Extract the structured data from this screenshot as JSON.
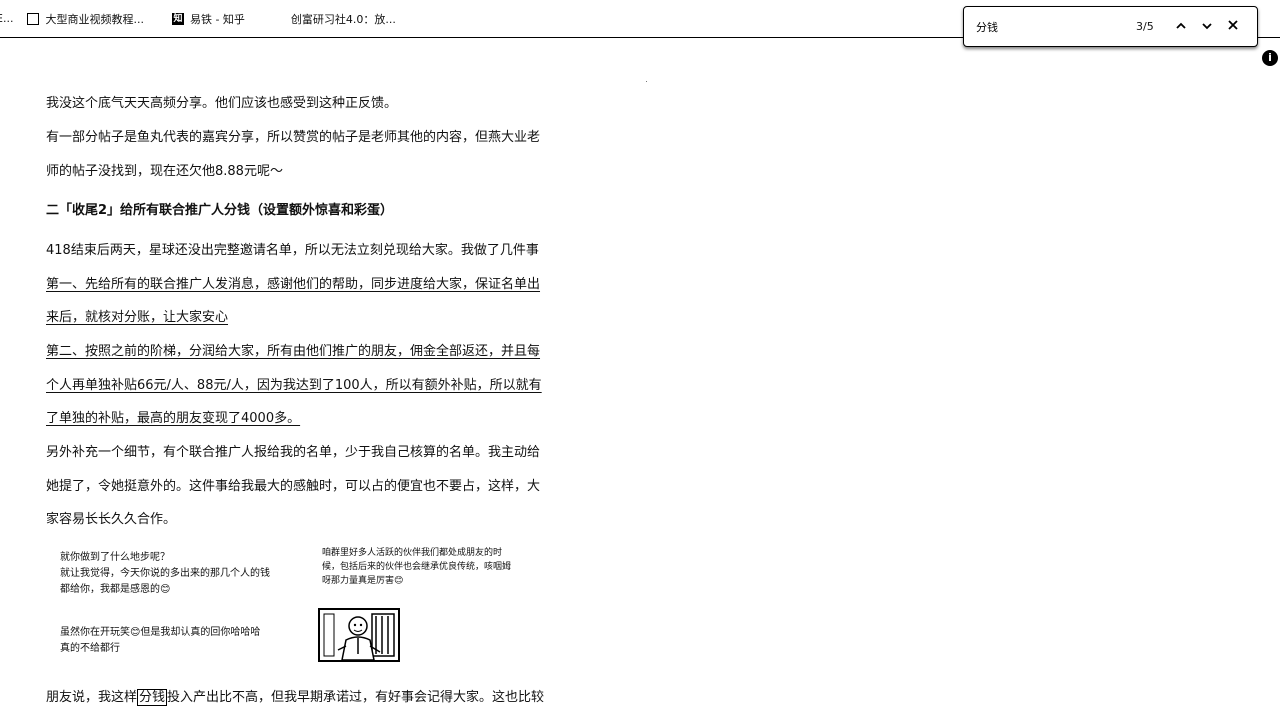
{
  "bookmarks": [
    {
      "icon": "page-icon",
      "label": "E..."
    },
    {
      "icon": "page-icon",
      "label": "大型商业视频教程..."
    },
    {
      "icon": "zhihu-icon",
      "label": "易铁 - 知乎"
    },
    {
      "icon": "page-icon",
      "label": "创富研习社4.0：放..."
    }
  ],
  "find_bar": {
    "query": "分钱",
    "count": "3/5",
    "prev_glyph": "︿",
    "next_glyph": "﹀",
    "close_glyph": "✕"
  },
  "article": {
    "p1": "我没这个底气天天高频分享。他们应该也感受到这种正反馈。",
    "p2a": "有一部分帖子是鱼丸代表的嘉宾分享，所以赞赏的帖子是老师其他的内容，但燕大业老",
    "p2b": "师的帖子没找到，现在还欠他8.88元呢～",
    "heading": "二「收尾2」给所有联合推广人分钱（设置额外惊喜和彩蛋）",
    "p3": "418结束后两天，星球还没出完整邀请名单，所以无法立刻兑现给大家。我做了几件事",
    "p4a": "第一、先给所有的联合推广人发消息，感谢他们的帮助，同步进度给大家，保证名单出",
    "p4b": "来后，就核对分账，让大家安心",
    "p5a": "第二、按照之前的阶梯，分润给大家，所有由他们推广的朋友，佣金全部返还，并且每",
    "p5b": "个人再单独补贴66元/人、88元/人，因为我达到了100人，所以有额外补贴，所以就有",
    "p5c": "了单独的补贴，最高的朋友变现了4000多。",
    "p6a": "另外补充一个细节，有个联合推广人报给我的名单，少于我自己核算的名单。我主动给",
    "p6b": "她提了，令她挺意外的。这件事给我最大的感触时，可以占的便宜也不要占，这样，大",
    "p6c": "家容易长长久久合作。",
    "p7_before": "朋友说，我这样",
    "p7_match": "分钱",
    "p7_after": "投入产出比不高，但我早期承诺过，有好事会记得大家。这也比较"
  },
  "chat": {
    "left1a": "就你做到了什么地步呢？",
    "left1b": "就让我觉得，今天你说的多出来的那几个人的钱",
    "left1c": "都给你，我都是感恩的😊",
    "left2a": "虽然你在开玩笑😊但是我却认真的回你哈哈哈",
    "left2b": "真的不给都行",
    "right1a": "咱群里好多人活跃的伙伴我们都处成朋友的时",
    "right1b": "候，包括后来的伙伴也会继承优良传统，咳咽姆",
    "right1c": "呀那力量真是厉害😊"
  }
}
